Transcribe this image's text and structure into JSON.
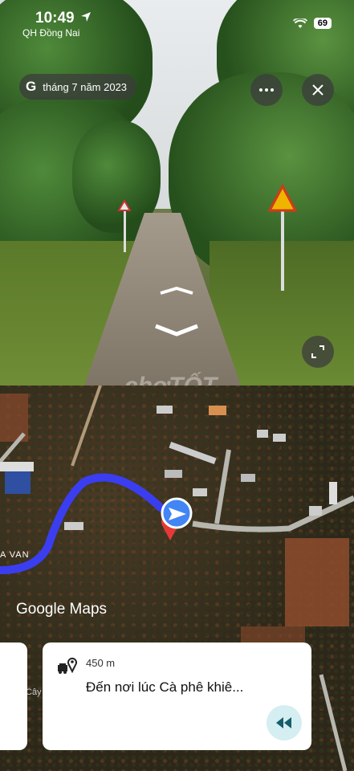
{
  "status_bar": {
    "time": "10:49",
    "carrier": "QH Đồng Nai",
    "battery": "69"
  },
  "street_view": {
    "date_label": "tháng 7 năm 2023",
    "more_icon": "more-horizontal-icon",
    "close_icon": "close-icon",
    "expand_icon": "expand-icon"
  },
  "watermark": "chợTỐT",
  "map": {
    "logo_text": "Google Maps",
    "road_label": "A VAN",
    "side_label": "Cây",
    "route_color": "#3a3ef0",
    "pin_color": "#e53935",
    "position_color": "#4285f4"
  },
  "nav_card": {
    "distance": "450 m",
    "destination": "Đến nơi lúc Cà phê khiê..."
  }
}
